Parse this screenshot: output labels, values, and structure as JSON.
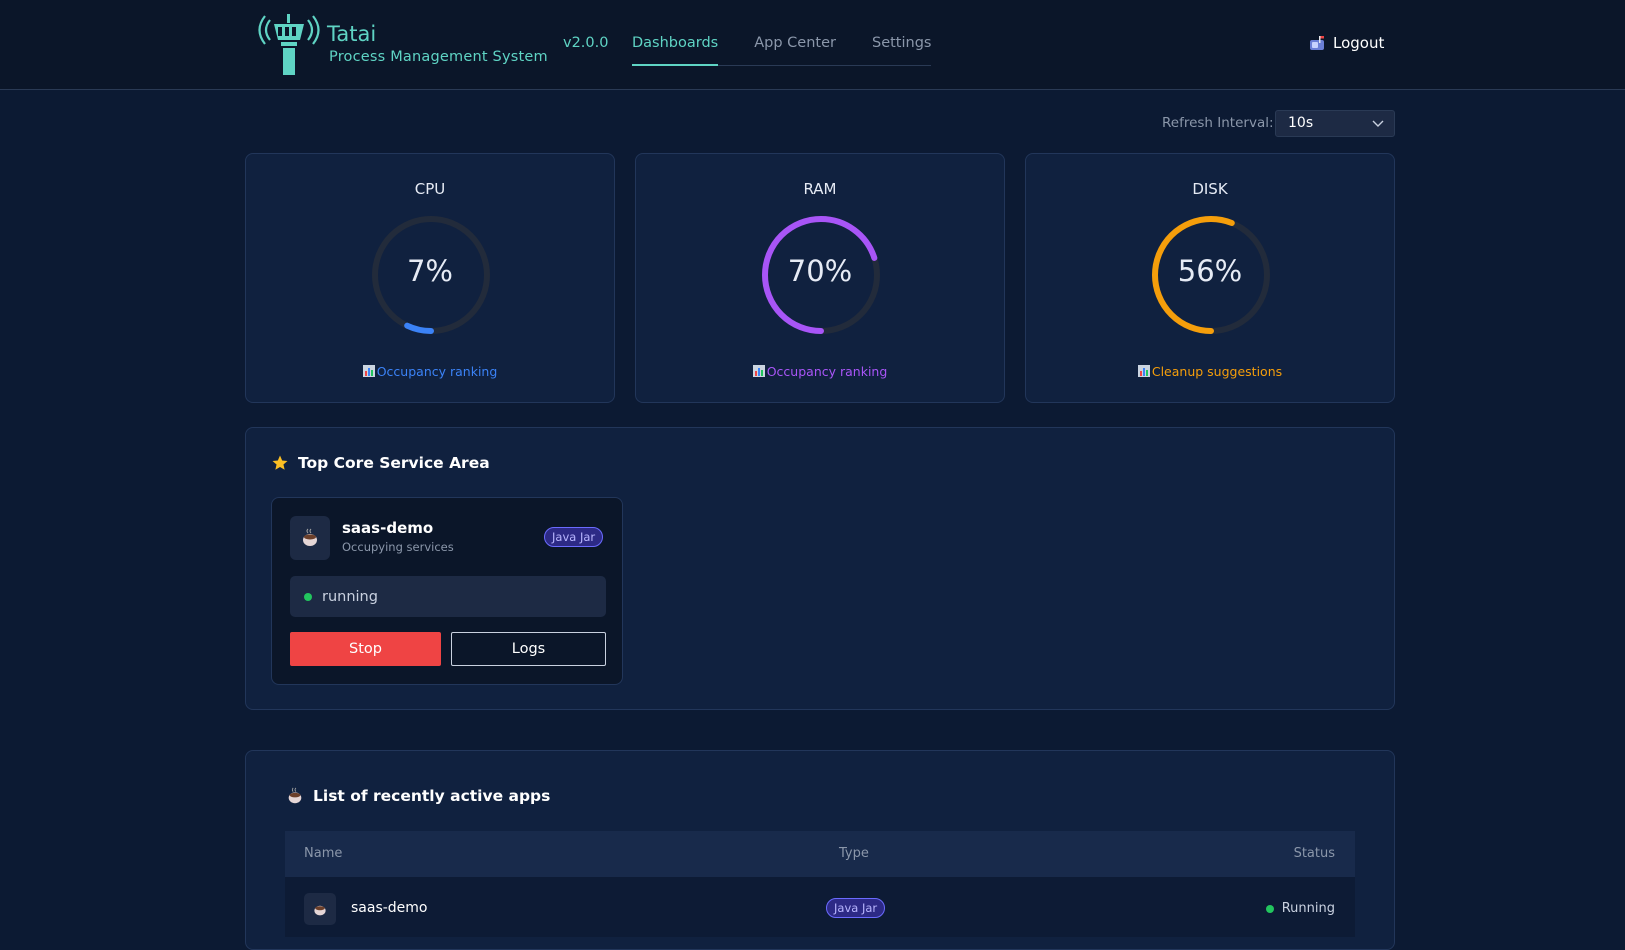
{
  "header": {
    "brand_name": "Tatai",
    "brand_subtitle": "Process Management System",
    "version": "v2.0.0",
    "tabs": [
      {
        "label": "Dashboards",
        "active": true
      },
      {
        "label": "App Center",
        "active": false
      },
      {
        "label": "Settings",
        "active": false
      }
    ],
    "logout_label": "Logout",
    "accent_color": "#5fd4c4"
  },
  "refresh": {
    "label": "Refresh Interval:",
    "value": "10s"
  },
  "stats": [
    {
      "title": "CPU",
      "percent": 7,
      "value_text": "7%",
      "link": "Occupancy ranking",
      "color": "#3b82f6",
      "link_icon": "bar-chart-icon"
    },
    {
      "title": "RAM",
      "percent": 70,
      "value_text": "70%",
      "link": "Occupancy ranking",
      "color": "#a855f7",
      "link_icon": "bar-chart-icon"
    },
    {
      "title": "DISK",
      "percent": 56,
      "value_text": "56%",
      "link": "Cleanup suggestions",
      "color": "#f59e0b",
      "link_icon": "bar-chart-icon"
    }
  ],
  "core_area": {
    "title": "Top Core Service Area",
    "title_icon": "star-icon",
    "service": {
      "name": "saas-demo",
      "subtitle": "Occupying services",
      "type": "Java Jar",
      "icon": "coffee-icon",
      "status": "running",
      "status_color": "#22c55e",
      "stop_label": "Stop",
      "logs_label": "Logs"
    }
  },
  "recent_apps": {
    "title": "List of recently active apps",
    "title_icon": "coffee-icon",
    "columns": [
      "Name",
      "Type",
      "Status"
    ],
    "rows": [
      {
        "name": "saas-demo",
        "type": "Java Jar",
        "status": "Running"
      }
    ]
  }
}
